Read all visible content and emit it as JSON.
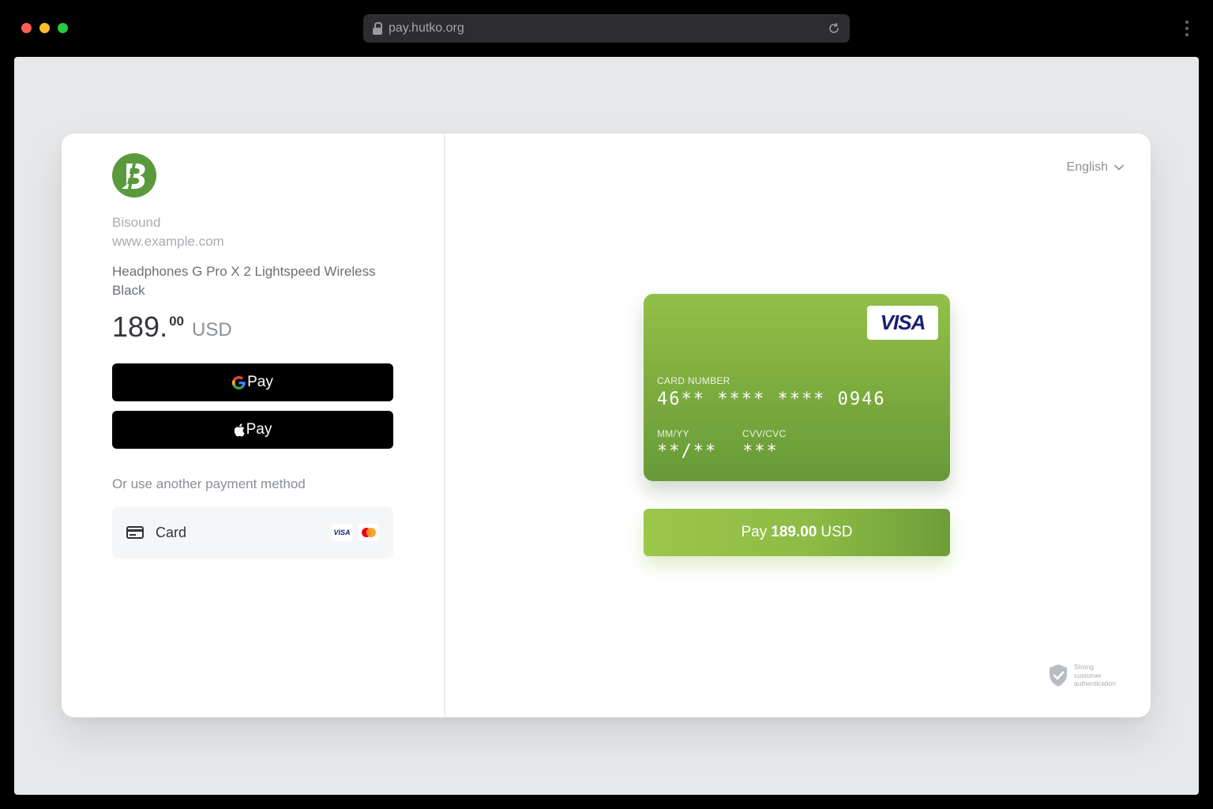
{
  "browser": {
    "url": "pay.hutko.org",
    "traffic_colors": {
      "close": "#ff5f57",
      "minimize": "#febc2e",
      "maximize": "#28c840"
    }
  },
  "merchant": {
    "name": "Bisound",
    "website": "www.example.com",
    "logo_color": "#5a9a3c"
  },
  "order": {
    "product": "Headphones G Pro X 2 Lightspeed Wireless Black",
    "price_integer": "189.",
    "price_decimal": "00",
    "currency": "USD"
  },
  "wallets": {
    "google_pay_label": "Pay",
    "apple_pay_label": "Pay"
  },
  "alternative": {
    "text": "Or use another payment method",
    "card_label": "Card",
    "brands": [
      "VISA",
      "mastercard"
    ]
  },
  "language": {
    "selected": "English"
  },
  "card": {
    "brand": "VISA",
    "number_label": "CARD NUMBER",
    "number_value": "46** **** **** 0946",
    "expiry_label": "MM/YY",
    "expiry_value": "**/**",
    "cvv_label": "CVV/CVC",
    "cvv_value": "***",
    "gradient": [
      "#93c049",
      "#679a38"
    ]
  },
  "submit": {
    "prefix": "Pay",
    "amount": "189.00",
    "currency": "USD"
  },
  "security": {
    "line1": "Strong",
    "line2": "customer",
    "line3": "authentication"
  },
  "icons": [
    "lock-icon",
    "reload-icon",
    "google-g-icon",
    "apple-icon",
    "card-icon",
    "chevron-down-icon",
    "shield-check-icon"
  ]
}
